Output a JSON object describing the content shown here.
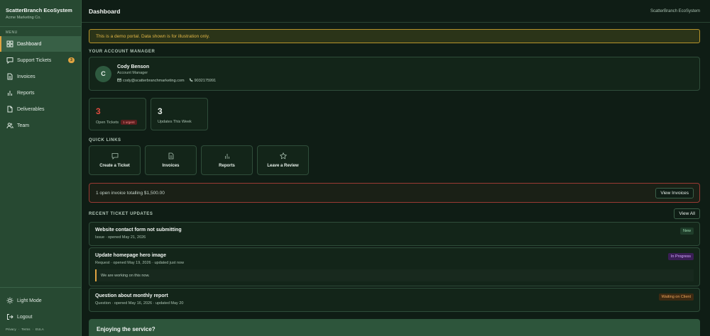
{
  "sidebar": {
    "brand_name": "ScatterBranch EcoSystem",
    "brand_sub": "Acme Marketing Co.",
    "menu_label": "MENU",
    "items": [
      {
        "label": "Dashboard",
        "icon": "grid-icon"
      },
      {
        "label": "Support Tickets",
        "icon": "chat-icon",
        "badge": "3"
      },
      {
        "label": "Invoices",
        "icon": "document-icon"
      },
      {
        "label": "Reports",
        "icon": "bar-chart-icon"
      },
      {
        "label": "Deliverables",
        "icon": "file-icon"
      },
      {
        "label": "Team",
        "icon": "users-icon"
      }
    ],
    "light_mode": "Light Mode",
    "logout": "Logout",
    "legal": [
      "Privacy",
      "·",
      "Terms",
      "·",
      "EULA"
    ]
  },
  "header": {
    "title": "Dashboard",
    "right_text": "ScatterBranch EcoSystem"
  },
  "demo_notice": "This is a demo portal. Data shown is for illustration only.",
  "account_manager": {
    "section_label": "YOUR ACCOUNT MANAGER",
    "initial": "C",
    "name": "Cody Benson",
    "role": "Account Manager",
    "email": "cody@scatterbranchmarketing.com",
    "phone": "9032175991"
  },
  "stats": {
    "open_tickets_value": "3",
    "open_tickets_label": "Open Tickets",
    "urgent_badge": "1 urgent",
    "updates_value": "3",
    "updates_label": "Updates This Week"
  },
  "quick_links": {
    "section_label": "QUICK LINKS",
    "items": [
      {
        "label": "Create a Ticket",
        "icon": "chat-icon"
      },
      {
        "label": "Invoices",
        "icon": "document-icon"
      },
      {
        "label": "Reports",
        "icon": "bar-chart-icon"
      },
      {
        "label": "Leave a Review",
        "icon": "star-icon"
      }
    ]
  },
  "invoice_alert": {
    "text": "1 open invoice totalling $1,500.00",
    "button": "View Invoices"
  },
  "recent": {
    "section_label": "RECENT TICKET UPDATES",
    "view_all": "View All",
    "tickets": [
      {
        "title": "Website contact form not submitting",
        "meta": "Issue · opened May 21, 2026",
        "status": "New"
      },
      {
        "title": "Update homepage hero image",
        "meta": "Request · opened May 19, 2026 · updated just now",
        "status": "In Progress",
        "note": "We are working on this now."
      },
      {
        "title": "Question about monthly report",
        "meta": "Question · opened May 16, 2026 · updated May 20",
        "status": "Waiting on Client"
      }
    ]
  },
  "enjoy_title": "Enjoying the service?",
  "colors": {
    "accent": "#e0a341",
    "sidebar_bg": "#274932",
    "page_bg": "#0f1d15",
    "urgent_red": "#e04a3f"
  }
}
